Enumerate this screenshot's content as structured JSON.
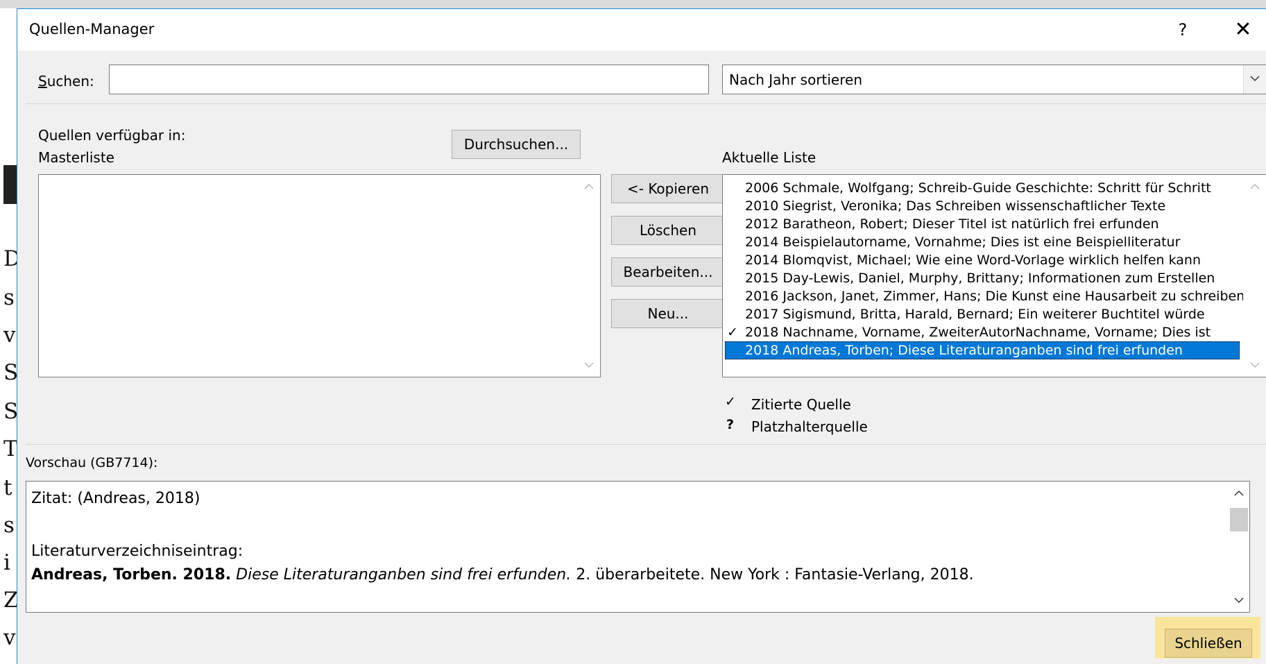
{
  "dialog": {
    "title": "Quellen-Manager",
    "help_label": "?",
    "close_label": "✕"
  },
  "search": {
    "label": "Suchen:",
    "value": "",
    "sort_selected": "Nach Jahr sortieren"
  },
  "master": {
    "label_line1": "Quellen verfügbar in:",
    "label_line2": "Masterliste",
    "browse_label": "Durchsuchen..."
  },
  "actions": {
    "copy_label": "<- Kopieren",
    "delete_label": "Löschen",
    "edit_label": "Bearbeiten...",
    "new_label": "Neu..."
  },
  "current": {
    "label": "Aktuelle Liste",
    "items": [
      {
        "check": "",
        "text": "2006 Schmale, Wolfgang; Schreib-Guide Geschichte: Schritt für Schritt"
      },
      {
        "check": "",
        "text": "2010 Siegrist, Veronika; Das Schreiben wissenschaftlicher Texte"
      },
      {
        "check": "",
        "text": "2012 Baratheon, Robert; Dieser Titel ist natürlich frei erfunden"
      },
      {
        "check": "",
        "text": "2014 Beispielautorname, Vornahme; Dies ist eine Beispielliteratur"
      },
      {
        "check": "",
        "text": "2014 Blomqvist, Michael; Wie eine Word-Vorlage wirklich helfen kann"
      },
      {
        "check": "",
        "text": "2015 Day-Lewis, Daniel, Murphy, Brittany; Informationen zum Erstellen"
      },
      {
        "check": "",
        "text": "2016 Jackson, Janet, Zimmer, Hans; Die Kunst eine Hausarbeit zu schreiben"
      },
      {
        "check": "",
        "text": "2017 Sigismund, Britta, Harald, Bernard; Ein weiterer Buchtitel würde"
      },
      {
        "check": "✓",
        "text": "2018 Nachname, Vorname, ZweiterAutorNachname, Vorname; Dies ist"
      },
      {
        "check": "",
        "text": "2018 Andreas, Torben; Diese Literaturanganben sind frei erfunden"
      }
    ]
  },
  "legend": {
    "cited_symbol": "✓",
    "cited_label": "Zitierte Quelle",
    "placeholder_symbol": "?",
    "placeholder_label": "Platzhalterquelle"
  },
  "preview": {
    "label": "Vorschau (GB7714):",
    "citation": "Zitat:  (Andreas, 2018)",
    "bib_heading": "Literaturverzeichniseintrag:",
    "bib_author": "Andreas, Torben. 2018.",
    "bib_title": "Diese Literaturanganben sind frei erfunden.",
    "bib_rest": "2. überarbeitete. New York : Fantasie-Verlang, 2018."
  },
  "footer": {
    "close_label": "Schließen"
  },
  "background_doc": {
    "heading_glyph": "I",
    "letters": [
      "D",
      "s",
      "v",
      "S",
      "S",
      "T",
      "t",
      "s",
      "i",
      "Z",
      "v"
    ]
  }
}
